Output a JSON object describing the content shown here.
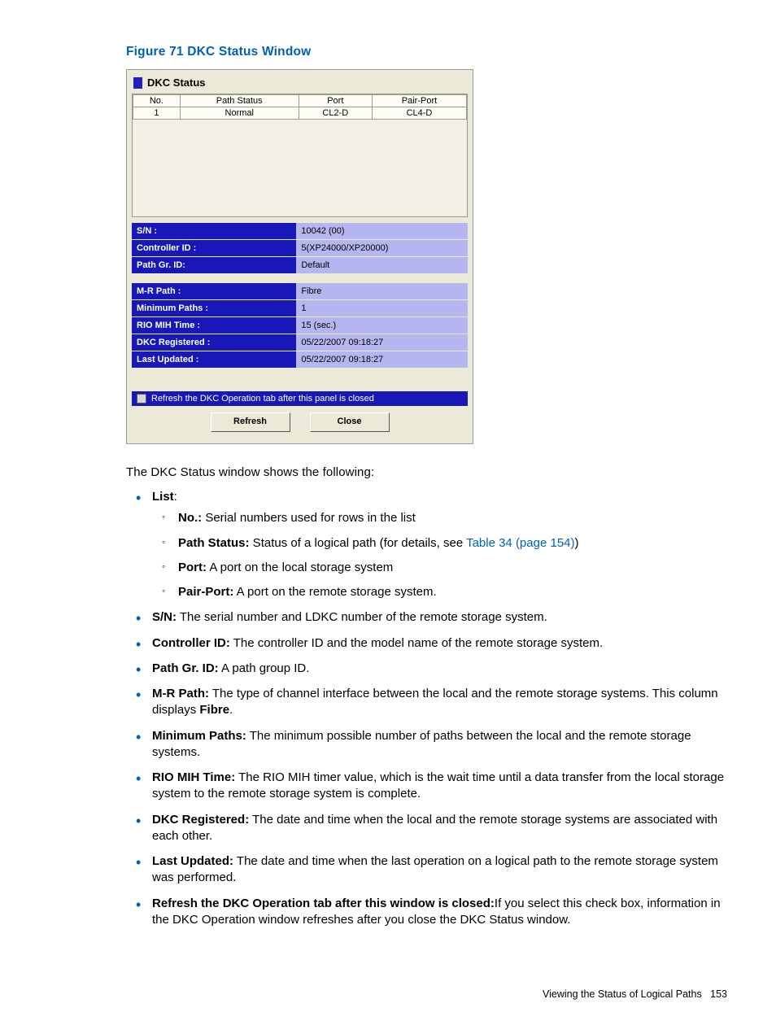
{
  "figure_title": "Figure 71 DKC Status Window",
  "window": {
    "title": "DKC Status",
    "columns": [
      "No.",
      "Path Status",
      "Port",
      "Pair-Port"
    ],
    "rows": [
      {
        "no": "1",
        "status": "Normal",
        "port": "CL2-D",
        "pair": "CL4-D"
      }
    ],
    "info1": [
      {
        "label": "S/N :",
        "value": "10042 (00)"
      },
      {
        "label": "Controller ID :",
        "value": "5(XP24000/XP20000)"
      },
      {
        "label": "Path Gr. ID:",
        "value": "Default"
      }
    ],
    "info2": [
      {
        "label": "M-R Path :",
        "value": "Fibre"
      },
      {
        "label": "Minimum Paths :",
        "value": "1"
      },
      {
        "label": "RIO MIH Time :",
        "value": "15 (sec.)"
      },
      {
        "label": "DKC Registered :",
        "value": "05/22/2007 09:18:27"
      },
      {
        "label": "Last Updated :",
        "value": "05/22/2007 09:18:27"
      }
    ],
    "refresh_text": "Refresh the DKC Operation tab after this panel is closed",
    "btn_refresh": "Refresh",
    "btn_close": "Close"
  },
  "intro": "The DKC Status window shows the following:",
  "list": {
    "list_label": "List",
    "sub": {
      "no": {
        "b": "No.:",
        "t": " Serial numbers used for rows in the list"
      },
      "path": {
        "b": "Path Status:",
        "t1": " Status of a logical path (for details, see ",
        "link": "Table 34 (page 154)",
        "t2": ")"
      },
      "port": {
        "b": "Port:",
        "t": " A port on the local storage system"
      },
      "pair": {
        "b": "Pair-Port:",
        "t": " A port on the remote storage system."
      }
    },
    "sn": {
      "b": "S/N:",
      "t": " The serial number and LDKC number of the remote storage system."
    },
    "ctrl": {
      "b": "Controller ID:",
      "t": " The controller ID and the model name of the remote storage system."
    },
    "pg": {
      "b": "Path Gr. ID:",
      "t": " A path group ID."
    },
    "mr": {
      "b": "M-R Path:",
      "t1": " The type of channel interface between the local and the remote storage systems. This column displays ",
      "b2": "Fibre",
      "t2": "."
    },
    "min": {
      "b": "Minimum Paths:",
      "t": " The minimum possible number of paths between the local and the remote storage systems."
    },
    "rio": {
      "b": "RIO MIH Time:",
      "t": " The RIO MIH timer value, which is the wait time until a data transfer from the local storage system to the remote storage system is complete."
    },
    "reg": {
      "b": "DKC Registered:",
      "t": " The date and time when the local and the remote storage systems are associated with each other."
    },
    "upd": {
      "b": "Last Updated:",
      "t": " The date and time when the last operation on a logical path to the remote storage system was performed."
    },
    "ref": {
      "b": "Refresh the DKC Operation tab after this window is closed:",
      "t": "If you select this check box, information in the DKC Operation window refreshes after you close the DKC Status window."
    }
  },
  "footer": {
    "label": "Viewing the Status of Logical Paths",
    "page": "153"
  }
}
